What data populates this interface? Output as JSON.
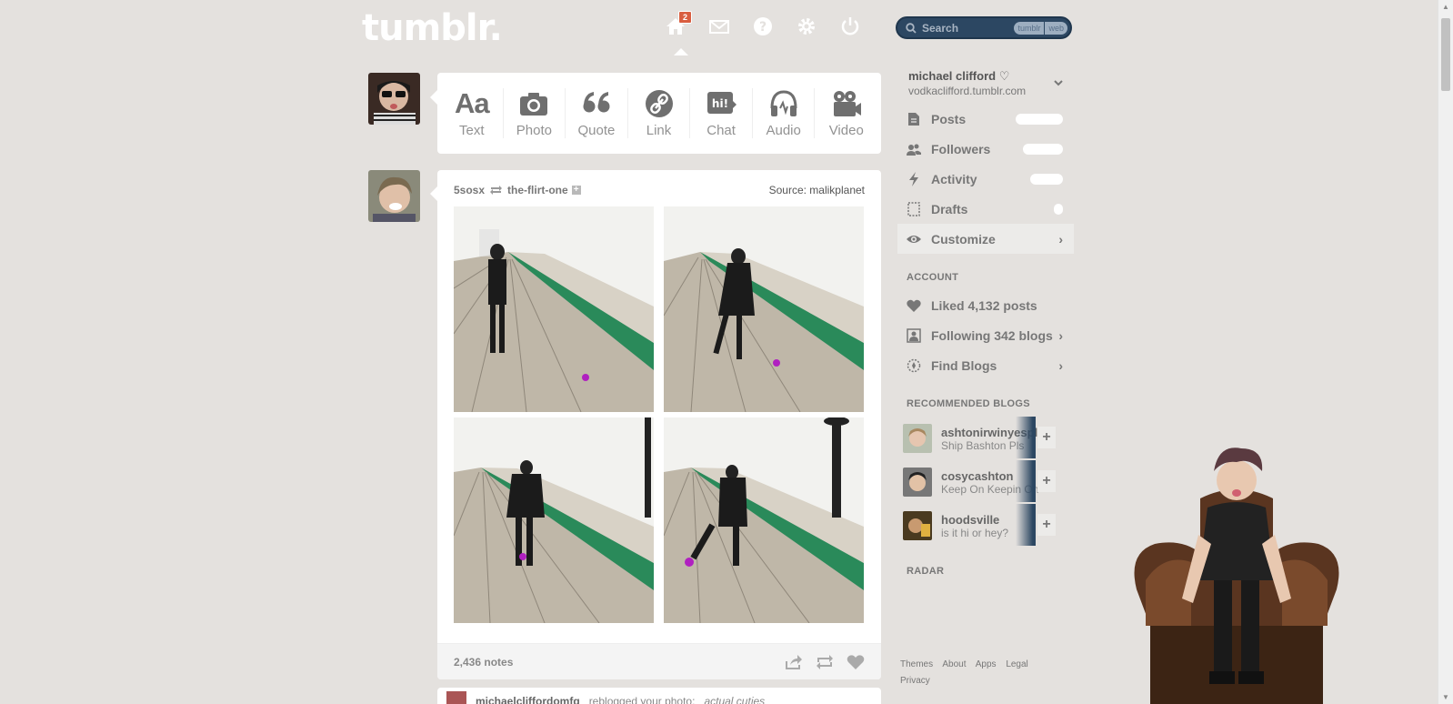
{
  "header": {
    "logo": "tumblr.",
    "home_badge": "2",
    "search_placeholder": "Search",
    "search_scope": [
      "tumblr",
      "web"
    ]
  },
  "post_types": [
    {
      "label": "Text",
      "icon": "text-icon"
    },
    {
      "label": "Photo",
      "icon": "camera-icon"
    },
    {
      "label": "Quote",
      "icon": "quote-icon"
    },
    {
      "label": "Link",
      "icon": "link-icon"
    },
    {
      "label": "Chat",
      "icon": "chat-icon"
    },
    {
      "label": "Audio",
      "icon": "headphones-icon"
    },
    {
      "label": "Video",
      "icon": "video-camera-icon"
    }
  ],
  "post": {
    "author": "5sosx",
    "reblogged_from": "the-flirt-one",
    "source": "Source: malikplanet",
    "notes": "2,436 notes"
  },
  "next_post": {
    "user": "michaelcliffordomfg",
    "text": "reblogged your photo:",
    "caption": "actual cuties"
  },
  "sidebar": {
    "blog_name": "michael clifford ♡",
    "blog_url": "vodkaclifford.tumblr.com",
    "items": [
      {
        "label": "Posts",
        "icon": "posts-icon"
      },
      {
        "label": "Followers",
        "icon": "followers-icon"
      },
      {
        "label": "Activity",
        "icon": "activity-icon"
      },
      {
        "label": "Drafts",
        "icon": "drafts-icon"
      },
      {
        "label": "Customize",
        "icon": "eye-icon"
      }
    ],
    "account_title": "ACCOUNT",
    "account_items": [
      {
        "label": "Liked 4,132 posts",
        "icon": "heart-icon"
      },
      {
        "label": "Following 342 blogs",
        "icon": "following-icon"
      },
      {
        "label": "Find Blogs",
        "icon": "compass-icon"
      }
    ],
    "recommended_title": "RECOMMENDED BLOGS",
    "recommended": [
      {
        "name": "ashtonirwinyesplease",
        "desc": "Ship Bashton Pls"
      },
      {
        "name": "cosycashton",
        "desc": "Keep On Keepin On"
      },
      {
        "name": "hoodsville",
        "desc": "is it hi or hey?"
      }
    ],
    "radar_title": "RADAR",
    "footer_links": [
      "Themes",
      "About",
      "Apps",
      "Legal",
      "Privacy"
    ]
  },
  "colors": {
    "background": "#e4e1de",
    "search_bg": "#2c4762",
    "badge": "#d95e40"
  }
}
